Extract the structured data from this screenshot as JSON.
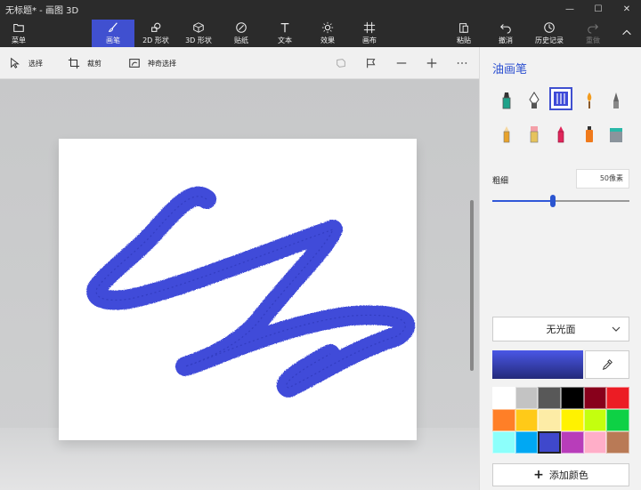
{
  "window": {
    "title": "无标题* - 画图 3D",
    "controls": {
      "minimize": "—",
      "maximize": "☐",
      "close": "✕"
    }
  },
  "ribbon": {
    "menu": "菜单",
    "tabs": [
      {
        "label": "画笔",
        "icon": "brush-icon",
        "active": true
      },
      {
        "label": "2D 形状",
        "icon": "shapes-2d-icon"
      },
      {
        "label": "3D 形状",
        "icon": "cube-icon"
      },
      {
        "label": "贴纸",
        "icon": "sticker-icon"
      },
      {
        "label": "文本",
        "icon": "text-icon"
      },
      {
        "label": "效果",
        "icon": "sun-icon"
      },
      {
        "label": "画布",
        "icon": "canvas-icon"
      }
    ],
    "right": [
      {
        "label": "粘贴",
        "icon": "paste-icon"
      },
      {
        "label": "撤消",
        "icon": "undo-icon"
      },
      {
        "label": "历史记录",
        "icon": "history-icon"
      },
      {
        "label": "重做",
        "icon": "redo-icon",
        "disabled": true
      }
    ]
  },
  "toolbar": {
    "select": "选择",
    "crop": "裁剪",
    "magic_select": "神奇选择"
  },
  "panel": {
    "title": "油画笔",
    "thickness_label": "粗细",
    "thickness_value": "50像素",
    "thickness_fraction": 0.44,
    "finish": "无光面",
    "add_color": "添加颜色",
    "selected_color": "#3f4bd9",
    "palette": [
      "#ffffff",
      "#c3c3c3",
      "#585858",
      "#000000",
      "#88001b",
      "#ec1c24",
      "#ff7f27",
      "#ffca18",
      "#fdeca6",
      "#fff200",
      "#c4ff0e",
      "#0ed145",
      "#8cfffb",
      "#00a8f3",
      "#3f48cc",
      "#b83dba",
      "#ffaec8",
      "#b97a56"
    ],
    "selected_swatch": 14
  },
  "stroke_color": "#3f4bd9"
}
